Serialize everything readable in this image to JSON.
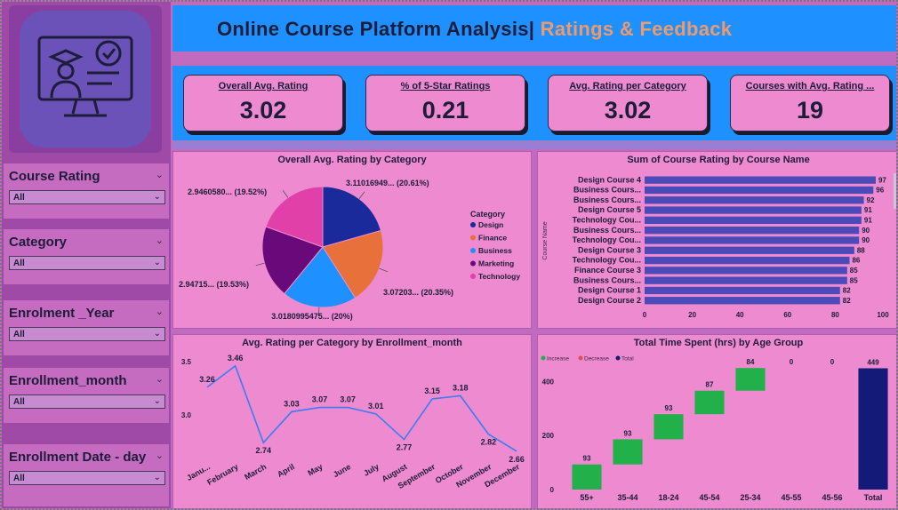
{
  "header": {
    "title_main": "Online Course Platform Analysis|",
    "title_sub": " Ratings & Feedback"
  },
  "colors": {
    "header_blue": "#1e90ff",
    "panel_pink": "#ee8ad0",
    "sidebar_purple": "#a04aa8",
    "bar_blue": "#4a4ab8",
    "line_blue": "#3a7ef0",
    "increase": "#22b04a",
    "decrease": "#e0504a",
    "total": "#141a78"
  },
  "logo": {
    "icon": "online-course-monitor-icon"
  },
  "kpis": [
    {
      "label": "Overall Avg. Rating",
      "value": "3.02"
    },
    {
      "label": "% of 5-Star Ratings",
      "value": "0.21"
    },
    {
      "label": "Avg. Rating per Category",
      "value": "3.02"
    },
    {
      "label": "Courses with Avg. Rating ...",
      "value": "19"
    }
  ],
  "slicers": [
    {
      "title": "Course Rating",
      "value": "All"
    },
    {
      "title": "Category",
      "value": "All"
    },
    {
      "title": "Enrolment _Year",
      "value": "All"
    },
    {
      "title": "Enrollment_month",
      "value": "All"
    },
    {
      "title": "Enrollment Date - day",
      "value": "All"
    }
  ],
  "chart_data": [
    {
      "type": "pie",
      "title": "Overall Avg. Rating by Category",
      "legend_title": "Category",
      "legend_position": "right",
      "slices": [
        {
          "name": "Design",
          "value": 20.61,
          "label": "3.11016949... (20.61%)",
          "color": "#1a2a9a"
        },
        {
          "name": "Finance",
          "value": 20.35,
          "label": "3.07203... (20.35%)",
          "color": "#e8703a"
        },
        {
          "name": "Business",
          "value": 20.0,
          "label": "3.0180995475... (20%)",
          "color": "#1e90ff"
        },
        {
          "name": "Marketing",
          "value": 19.53,
          "label": "2.94715... (19.53%)",
          "color": "#6a0a7a"
        },
        {
          "name": "Technology",
          "value": 19.52,
          "label": "2.9460580... (19.52%)",
          "color": "#e040a8"
        }
      ]
    },
    {
      "type": "bar",
      "orientation": "horizontal",
      "title": "Sum of Course Rating by Course Name",
      "ylabel": "Course Name",
      "xlim": [
        0,
        100
      ],
      "xticks": [
        0,
        20,
        40,
        60,
        80,
        100
      ],
      "categories": [
        "Design Course 4",
        "Business Cours...",
        "Business Cours...",
        "Design Course 5",
        "Technology Cou...",
        "Business Cours...",
        "Technology Cou...",
        "Design Course 3",
        "Technology Cou...",
        "Finance Course 3",
        "Business Cours...",
        "Design Course 1",
        "Design Course 2"
      ],
      "values": [
        97,
        96,
        92,
        91,
        91,
        90,
        90,
        88,
        86,
        85,
        85,
        82,
        82
      ]
    },
    {
      "type": "line",
      "title": "Avg. Rating per Category by Enrollment_month",
      "categories": [
        "Janu...",
        "February",
        "March",
        "April",
        "May",
        "June",
        "July",
        "August",
        "September",
        "October",
        "November",
        "December"
      ],
      "values": [
        3.26,
        3.46,
        2.74,
        3.03,
        3.07,
        3.07,
        3.01,
        2.77,
        3.15,
        3.18,
        2.82,
        2.66
      ],
      "ylim": [
        2.6,
        3.55
      ],
      "yticks": [
        3.0,
        3.5
      ]
    },
    {
      "type": "bar",
      "subtype": "waterfall",
      "title": "Total Time Spent (hrs) by Age Group",
      "legend": [
        "Increase",
        "Decrease",
        "Total"
      ],
      "legend_position": "top-left",
      "categories": [
        "55+",
        "35-44",
        "18-24",
        "45-54",
        "25-34",
        "45-55",
        "45-56",
        "Total"
      ],
      "values": [
        93,
        93,
        93,
        87,
        84,
        0,
        0,
        449
      ],
      "ylim": [
        0,
        500
      ],
      "yticks": [
        0,
        200,
        400
      ]
    }
  ]
}
